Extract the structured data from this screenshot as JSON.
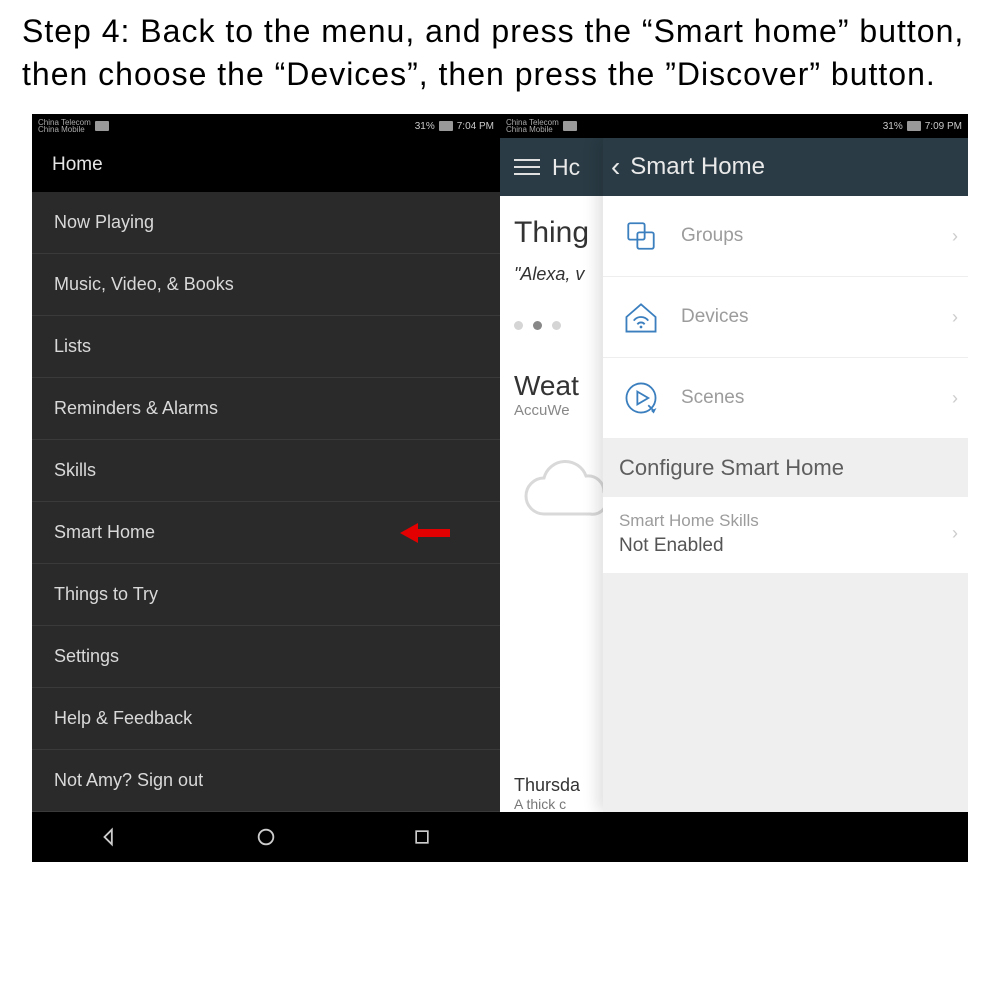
{
  "instruction": "Step 4: Back to the menu, and press the “Smart home” button, then choose the “Devices”, then press the ”Discover” button.",
  "left": {
    "status": {
      "carrier_top": "China Telecom",
      "carrier_bot": "China Mobile",
      "battery_pct": "31%",
      "time": "7:04 PM"
    },
    "menu": {
      "header": "Home",
      "items": [
        "Now Playing",
        "Music, Video, & Books",
        "Lists",
        "Reminders & Alarms",
        "Skills",
        "Smart Home",
        "Things to Try",
        "Settings",
        "Help & Feedback",
        "Not Amy? Sign out"
      ]
    }
  },
  "right": {
    "status": {
      "carrier_top": "China Telecom",
      "carrier_bot": "China Mobile",
      "battery_pct": "31%",
      "time": "7:09 PM"
    },
    "appbar_partial": "Hc",
    "behind": {
      "thing_heading": "Thing",
      "thing_sub": "\"Alexa, v",
      "weather_heading": "Weat",
      "weather_sub": "AccuWe",
      "thursday": "Thursda",
      "thursday_sub": "A thick c"
    },
    "panel": {
      "title": "Smart Home",
      "rows": [
        {
          "label": "Groups"
        },
        {
          "label": "Devices"
        },
        {
          "label": "Scenes"
        }
      ],
      "section_title": "Configure Smart Home",
      "skills_label": "Smart Home Skills",
      "skills_value": "Not Enabled"
    }
  }
}
